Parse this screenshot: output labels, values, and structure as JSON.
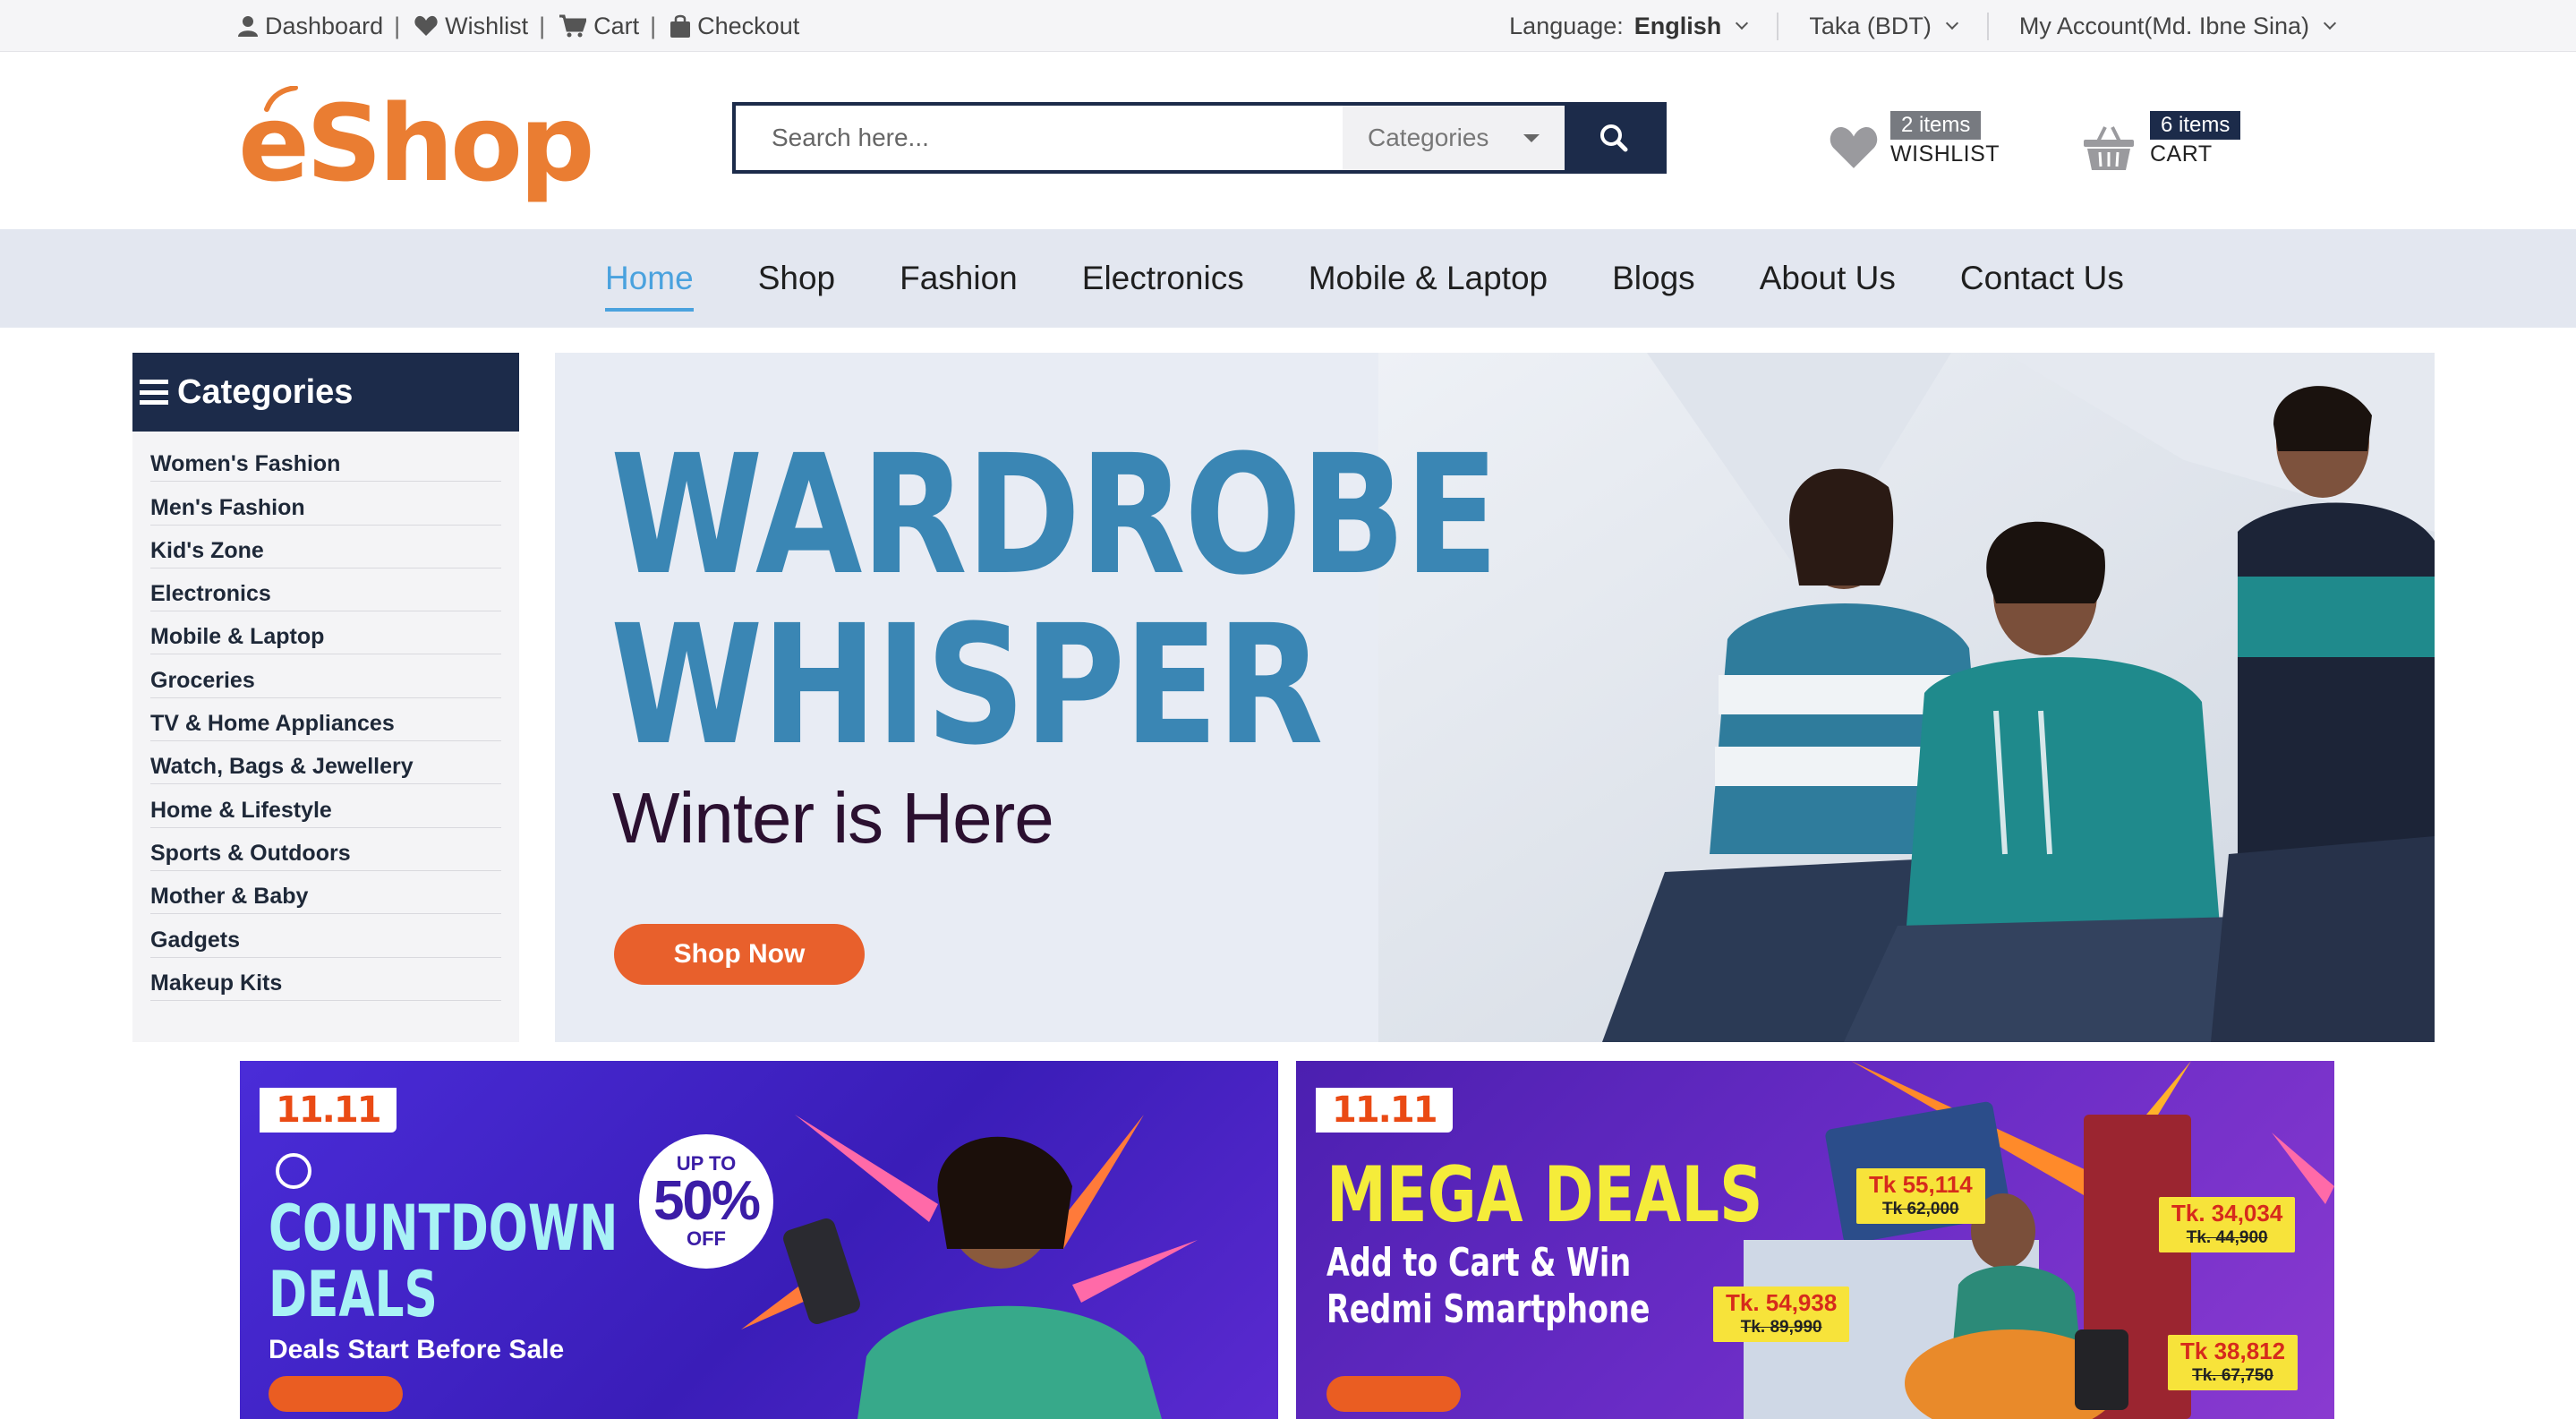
{
  "topbar": {
    "links": [
      {
        "label": "Dashboard",
        "icon": "user-icon"
      },
      {
        "label": "Wishlist",
        "icon": "heart-icon"
      },
      {
        "label": "Cart",
        "icon": "cart-icon"
      },
      {
        "label": "Checkout",
        "icon": "bag-icon"
      }
    ],
    "separator": "|",
    "language_prefix": "Language:",
    "language_value": "English",
    "currency": "Taka (BDT)",
    "account": "My Account(Md. Ibne Sina)"
  },
  "header": {
    "logo_text": "eShop",
    "search_placeholder": "Search here...",
    "category_select": "Categories",
    "wishlist_badge": "2 items",
    "wishlist_label": "WISHLIST",
    "cart_badge": "6 items",
    "cart_label": "CART"
  },
  "nav": {
    "items": [
      "Home",
      "Shop",
      "Fashion",
      "Electronics",
      "Mobile & Laptop",
      "Blogs",
      "About Us",
      "Contact Us"
    ],
    "active": "Home"
  },
  "sidebar": {
    "title": "Categories",
    "items": [
      "Women's Fashion",
      "Men's Fashion",
      "Kid's Zone",
      "Electronics",
      "Mobile & Laptop",
      "Groceries",
      "TV & Home Appliances",
      "Watch, Bags & Jewellery",
      "Home & Lifestyle",
      "Sports & Outdoors",
      "Mother & Baby",
      "Gadgets",
      "Makeup Kits"
    ]
  },
  "hero": {
    "line1": "WARDROBE",
    "line2": "WHISPER",
    "subtitle": "Winter is Here",
    "cta": "Shop Now"
  },
  "promo1": {
    "tag": "11.11",
    "title_line1": "COUNTDOWN",
    "title_line2": "DEALS",
    "subtitle": "Deals Start Before Sale",
    "badge_top": "UP TO",
    "badge_value": "50%",
    "badge_bottom": "OFF"
  },
  "promo2": {
    "tag": "11.11",
    "title": "MEGA DEALS",
    "sub_line1": "Add to Cart & Win",
    "sub_line2": "Redmi Smartphone",
    "prices": [
      {
        "price": "Tk 55,114",
        "old": "Tk 62,000"
      },
      {
        "price": "Tk. 34,034",
        "old": "Tk. 44,900"
      },
      {
        "price": "Tk. 54,938",
        "old": "Tk. 89,990"
      },
      {
        "price": "Tk 38,812",
        "old": "Tk. 67,750"
      }
    ]
  },
  "colors": {
    "navy": "#1c2b4a",
    "brand_orange": "#ea7d32",
    "nav_active": "#4aa2de",
    "nav_bg": "#e3e7f0",
    "hero_title": "#3a86b4",
    "cta_orange": "#e8602c"
  }
}
